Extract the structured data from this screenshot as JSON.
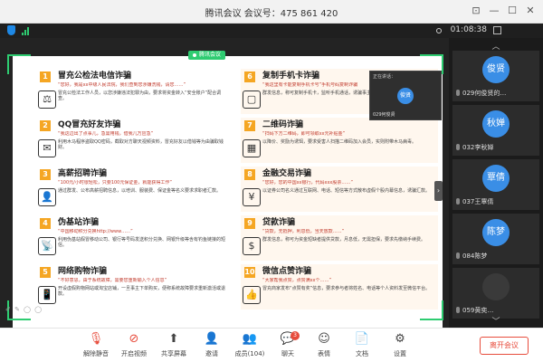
{
  "window": {
    "title": "腾讯会议 会议号：475 861 420"
  },
  "status": {
    "timer": "01:08:38"
  },
  "share_tag": "腾讯会议",
  "slide": {
    "cards_left": [
      {
        "num": "1",
        "title": "冒充公检法电信诈骗",
        "sub": "“您好，我是xx中级人民法院，我们查到您涉嫌洗钱，请您……”",
        "icon": "⚖",
        "desc": "冒充公检法工作人员，以您涉嫌违法犯罪为由，要求将资金转入“安全账户”配合调查。"
      },
      {
        "num": "2",
        "title": "QQ冒充好友诈骗",
        "sub": "“我这边出了点事儿，急需用钱，借我几万应急”",
        "icon": "✉",
        "desc": "利用木马程序盗取QQ密码，截取对方聊天视频资料，冒充好友以借钱等为由骗取钱财。"
      },
      {
        "num": "3",
        "title": "高薪招聘诈骗",
        "sub": "“100元/小时很轻松，只要100元保证金，就能获得工作”",
        "icon": "👤",
        "desc": "通过群发、公布高薪招聘信息，以培训、服装费、保证金等名义要求求职者汇款。"
      },
      {
        "num": "4",
        "title": "伪基站诈骗",
        "sub": "“中国移动积分兑换http://www……”",
        "icon": "📡",
        "desc": "利用伪基站假冒移动公司、银行等号码发送积分兑换、网银升级等含有钓鱼链接的短信。"
      },
      {
        "num": "5",
        "title": "网络购物诈骗",
        "sub": "“不好意思，由于系统故障，需要您重新输入个人信息”",
        "icon": "📱",
        "desc": "开设虚假购物网站或淘宝店铺，一旦事主下单购买，便称系统故障要求重新激活或退款。"
      }
    ],
    "cards_right": [
      {
        "num": "6",
        "title": "复制手机卡诈骗",
        "sub": "“我这里有卡能复制手机卡号”手机号码复制诈骗",
        "icon": "▢",
        "desc": "群发信息，称可复制手机卡，监听手机通话，诱骗事主汇款购买。"
      },
      {
        "num": "7",
        "title": "二维码诈骗",
        "sub": "“扫码下方二维码，即可领取xx元补贴金”",
        "icon": "▦",
        "desc": "以降价、奖励为诱饵，要求受害人扫描二维码加入会员，实则附带木马病毒。"
      },
      {
        "num": "8",
        "title": "金融交易诈骗",
        "sub": "“您好，您的中国xx银行，代码xxx股票……”",
        "icon": "¥",
        "desc": "以证券公司名义通过互联网、电话、短信等方式散布虚假个股内幕信息，诱骗汇款。"
      },
      {
        "num": "9",
        "title": "贷款诈骗",
        "sub": "“贷款，无抵押，利息低，当天放款……”",
        "icon": "$",
        "desc": "群发信息，称可为资金短缺者提供贷款，月息低，无需担保，要求先缴纳手续费。"
      },
      {
        "num": "10",
        "title": "微信点赞诈骗",
        "sub": "“大家帮我点赞，点赞满xx个……”",
        "icon": "👍",
        "desc": "冒充商家发布“点赞有奖”信息，要求参与者将姓名、电话等个人资料发至微信平台。"
      }
    ]
  },
  "mini_video": {
    "label": "正在讲话：",
    "avatar": "俊贤",
    "name": "029何俊贤"
  },
  "annotation_tools": "✐ ✎ ◯ ◯",
  "participants": [
    {
      "avatar": "俊贤",
      "name": "029何俊贤的…"
    },
    {
      "avatar": "秋婵",
      "name": "032李秋婵"
    },
    {
      "avatar": "覃倩",
      "name": "037王覃倩"
    },
    {
      "avatar": "陈梦",
      "name": "084陈梦"
    },
    {
      "avatar": "",
      "name": "059黄奕…"
    }
  ],
  "toolbar": {
    "mute": "解除静音",
    "video": "开启视频",
    "share": "共享屏幕",
    "invite": "邀请",
    "members": "成员(104)",
    "chat": "聊天",
    "chat_badge": "3",
    "reaction": "表情",
    "docs": "文档",
    "settings": "设置",
    "leave": "离开会议"
  },
  "colors": {
    "accent_green": "#2ecc71",
    "avatar_blue": "#3a8ee6",
    "number_orange": "#f5a623",
    "leave_red": "#e74c3c"
  }
}
